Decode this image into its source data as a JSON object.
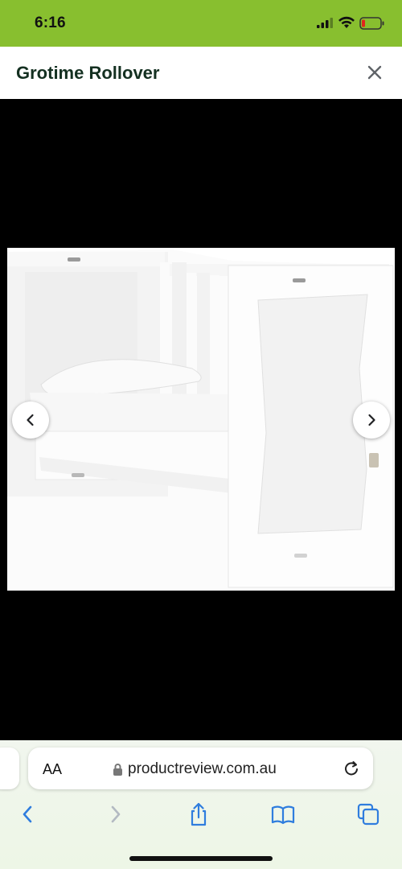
{
  "status_bar": {
    "time": "6:16",
    "icons": [
      "cellular-signal-icon",
      "wifi-icon",
      "battery-low-icon"
    ],
    "background": "#88bf2f"
  },
  "header": {
    "title": "Grotime Rollover",
    "close_icon": "close-icon"
  },
  "viewer": {
    "image_description": "white convertible cot with mattress and pillow",
    "prev_icon": "chevron-left-icon",
    "next_icon": "chevron-right-icon"
  },
  "browser": {
    "text_size_label": "AA",
    "url": "productreview.com.au",
    "reload_icon": "reload-icon",
    "toolbar": [
      "back-icon",
      "forward-icon",
      "share-icon",
      "bookmarks-icon",
      "tabs-icon"
    ],
    "accent": "#2f7dde"
  }
}
